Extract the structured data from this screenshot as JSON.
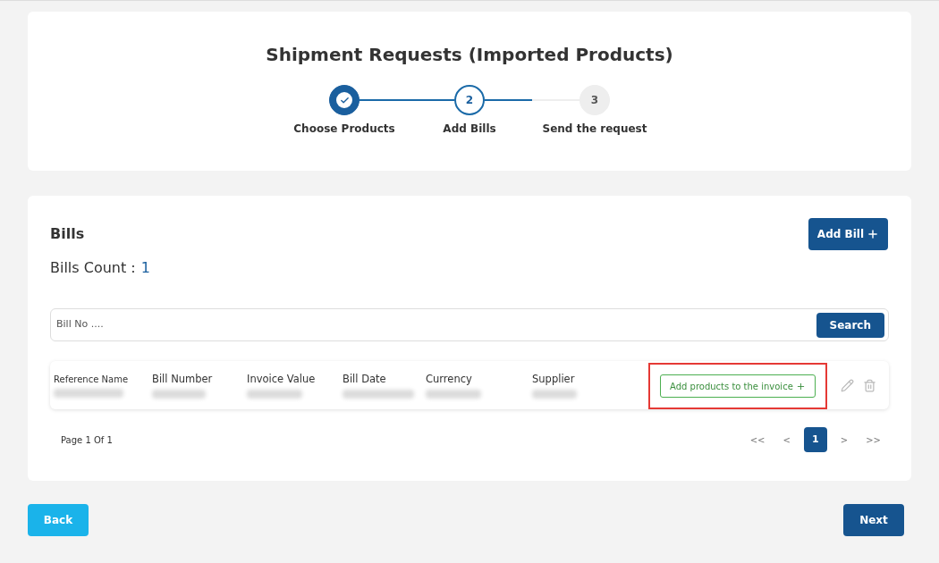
{
  "title": "Shipment Requests (Imported Products)",
  "steps": [
    {
      "label": "Choose Products",
      "completed": true,
      "selected": false
    },
    {
      "number": "2",
      "label": "Add Bills",
      "completed": false,
      "selected": true
    },
    {
      "number": "3",
      "label": "Send the request",
      "completed": false,
      "selected": false
    }
  ],
  "bills": {
    "heading": "Bills",
    "add_button": "Add Bill",
    "count_label": "Bills Count :",
    "count": "1",
    "search": {
      "placeholder": "Bill No ....",
      "button": "Search"
    },
    "columns": [
      "Reference Name",
      "Bill Number",
      "Invoice Value",
      "Bill Date",
      "Currency",
      "Supplier"
    ],
    "row_action": {
      "label": "Add products to the invoice",
      "highlighted": true
    },
    "pagination": {
      "info": "Page 1 Of 1",
      "first": "<<",
      "prev": "<",
      "pages": [
        {
          "label": "1",
          "selected": true
        }
      ],
      "next": ">",
      "last": ">>"
    }
  },
  "footer": {
    "back": "Back",
    "next": "Next"
  }
}
